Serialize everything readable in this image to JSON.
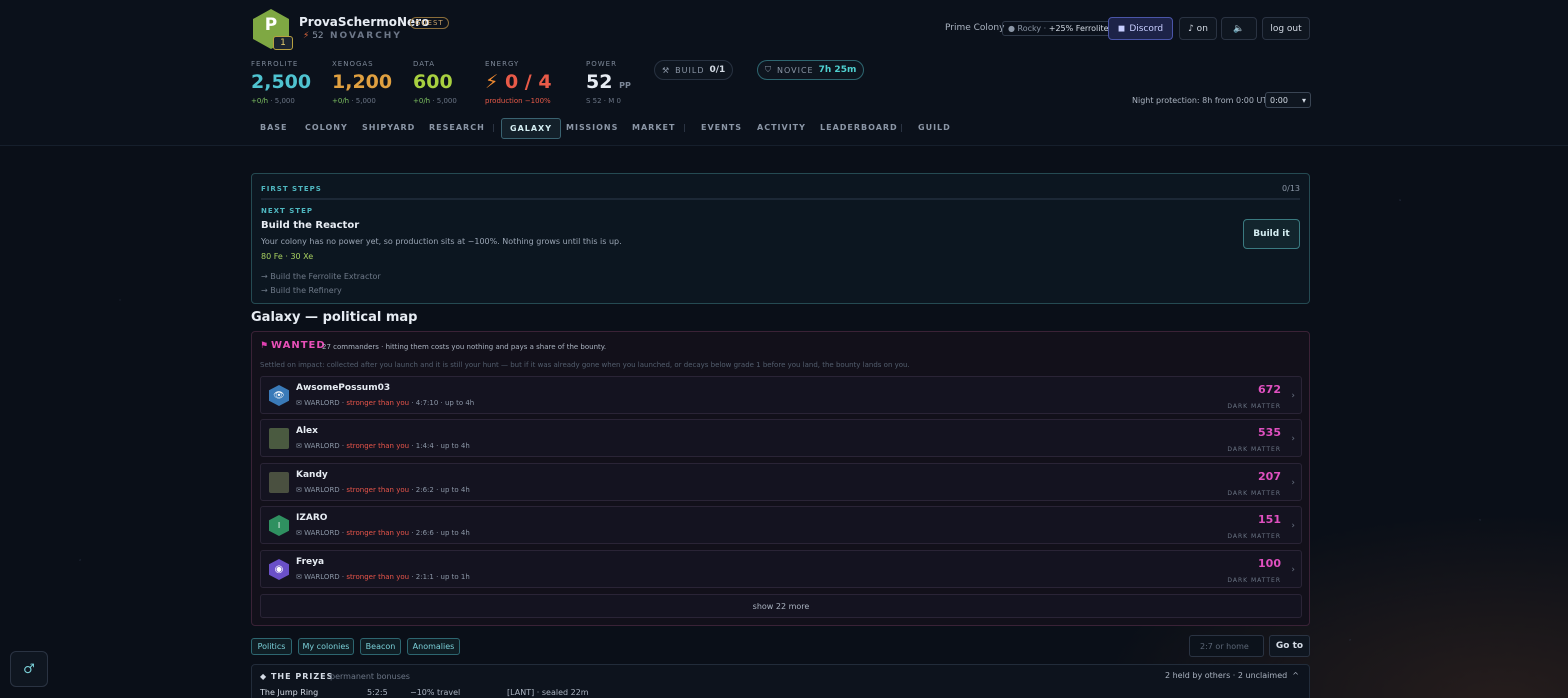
{
  "player": {
    "initial": "P",
    "level": "1",
    "name": "ProvaSchermoNero",
    "guest_badge": "GUEST",
    "power_score": "52",
    "faction": "NOVARCHY"
  },
  "resources": [
    {
      "label": "FERROLITE",
      "value": "2,500",
      "rate": "+0/h",
      "cap": " · 5,000",
      "color": "#4fc3d0"
    },
    {
      "label": "XENOGAS",
      "value": "1,200",
      "rate": "+0/h",
      "cap": " · 5,000",
      "color": "#e0a040"
    },
    {
      "label": "DATA",
      "value": "600",
      "rate": "+0/h",
      "cap": " · 5,000",
      "color": "#a8d040"
    },
    {
      "label": "ENERGY",
      "value": "0 / 4",
      "sub": "production −100%",
      "color": "#e85a48"
    },
    {
      "label": "POWER",
      "value": "52",
      "unit": "PP",
      "sub": "S 52 · M 0",
      "color": "#e7ecf3"
    }
  ],
  "chips": {
    "build_label": "BUILD",
    "build_value": "0/1",
    "novice_label": "NOVICE",
    "novice_value": "7h 25m"
  },
  "topbar": {
    "colony": "Prime Colony",
    "rocky": "Rocky",
    "rocky_bonus": "+25% Ferrolite",
    "discord": "Discord",
    "music": "♪ on",
    "sound": "🔈",
    "logout": "log out",
    "night_text": "Night protection: 8h from 0:00 UTC",
    "night_value": "0:00"
  },
  "nav": {
    "base": "BASE",
    "colony": "COLONY",
    "shipyard": "SHIPYARD",
    "research": "RESEARCH",
    "galaxy": "GALAXY",
    "missions": "MISSIONS",
    "market": "MARKET",
    "events": "EVENTS",
    "activity": "ACTIVITY",
    "leaderboard": "LEADERBOARD",
    "guild": "GUILD"
  },
  "first_steps": {
    "title": "FIRST STEPS",
    "count": "0/13",
    "next_label": "NEXT STEP",
    "heading": "Build the Reactor",
    "description": "Your colony has no power yet, so production sits at −100%. Nothing grows until this is up.",
    "cost": "80 Fe · 30 Xe",
    "upcoming": [
      "→ Build the Ferrolite Extractor",
      "→ Build the Refinery"
    ],
    "button": "Build it"
  },
  "galaxy_title": "Galaxy — political map",
  "wanted": {
    "flag": "⚑",
    "title": "WANTED",
    "description": "27 commanders · hitting them costs you nothing and pays a share of the bounty.",
    "note": "Settled on impact: collected after you launch and it is still your hunt — but if it was already gone when you launched, or decays below grade 1 before you land, the bounty lands on you.",
    "rows": [
      {
        "name": "AwsomePossum03",
        "role": "✉ WARLORD",
        "strength": "stronger than you",
        "coords": "· 4:7:10 · up to 4h",
        "dark_matter": "672",
        "dm_label": "DARK MATTER",
        "avatar_color": "#3a7ab8",
        "avatar_glyph": "●"
      },
      {
        "name": "Alex",
        "role": "✉ WARLORD",
        "strength": "stronger than you",
        "coords": "· 1:4:4 · up to 4h",
        "dark_matter": "535",
        "dm_label": "DARK MATTER",
        "avatar_color": "#4a5a40",
        "avatar_glyph": ""
      },
      {
        "name": "Kandy",
        "role": "✉ WARLORD",
        "strength": "stronger than you",
        "coords": "· 2:6:2 · up to 4h",
        "dark_matter": "207",
        "dm_label": "DARK MATTER",
        "avatar_color": "#4a5040",
        "avatar_glyph": ""
      },
      {
        "name": "IZARO",
        "role": "✉ WARLORD",
        "strength": "stronger than you",
        "coords": "· 2:6:6 · up to 4h",
        "dark_matter": "151",
        "dm_label": "DARK MATTER",
        "avatar_color": "#2f9060",
        "avatar_glyph": "I"
      },
      {
        "name": "Freya",
        "role": "✉ WARLORD",
        "strength": "stronger than you",
        "coords": "· 2:1:1 · up to 1h",
        "dark_matter": "100",
        "dm_label": "DARK MATTER",
        "avatar_color": "#6a50c8",
        "avatar_glyph": "◉"
      }
    ],
    "show_more": "show 22 more"
  },
  "filters": {
    "politics": "Politics",
    "my_colonies": "My colonies",
    "beacon": "Beacon",
    "anomalies": "Anomalies",
    "goto_placeholder": "2:7 or home",
    "goto_button": "Go to"
  },
  "prizes": {
    "title": "◆ THE PRIZES",
    "subtitle": "permanent bonuses",
    "summary": "2 held by others · 2 unclaimed",
    "caret": "^",
    "row": {
      "name": "The Jump Ring",
      "coords": "5:2:5",
      "effect": "−10% travel",
      "holder": "[LANT] · sealed 22m"
    }
  }
}
